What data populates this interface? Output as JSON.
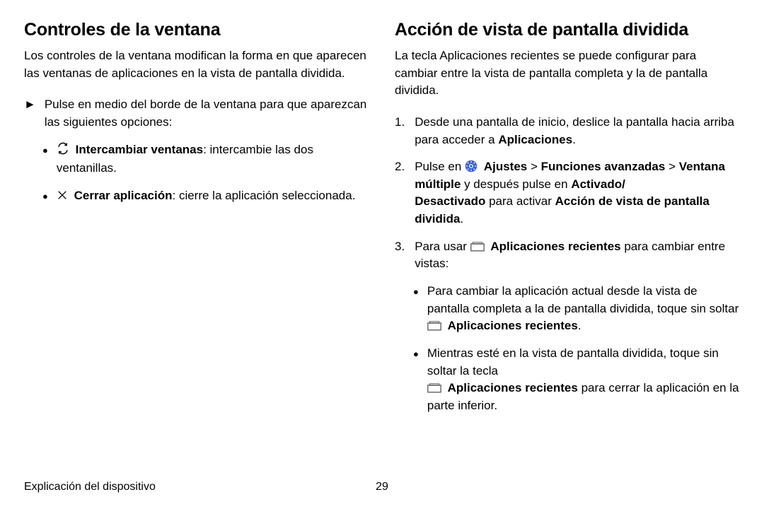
{
  "left": {
    "heading": "Controles de la ventana",
    "lead": "Los controles de la ventana modifican la forma en que aparecen las ventanas de aplicaciones en la vista de pantalla dividida.",
    "arrow_text": "Pulse en medio del borde de la ventana para que aparezcan las siguientes opciones:",
    "sub1_bold": "Intercambiar ventanas",
    "sub1_rest": ": intercambie las dos ventanillas.",
    "sub2_bold": "Cerrar aplicación",
    "sub2_rest": ": cierre la aplicación seleccionada."
  },
  "right": {
    "heading": "Acción de vista de pantalla dividida",
    "lead": "La tecla Aplicaciones recientes se puede configurar para cambiar entre la vista de pantalla completa y la de pantalla dividida.",
    "s1a": "Desde una pantalla de inicio, deslice la pantalla hacia arriba para acceder a ",
    "s1b": "Aplicaciones",
    "s1c": ".",
    "s2a": "Pulse en ",
    "s2b": "Ajustes",
    "s2c": " > ",
    "s2d": "Funciones avanzadas",
    "s2e": " > ",
    "s2f": "Ventana múltiple",
    "s2g": " y después pulse en ",
    "s2h": "Activado/",
    "s2h2": "Desactivado",
    "s2i": " para activar ",
    "s2j": "Acción de vista de pantalla dividida",
    "s2k": ".",
    "s3a": "Para usar ",
    "s3b": "Aplicaciones recientes",
    "s3c": " para cambiar entre vistas:",
    "b1a": "Para cambiar la aplicación actual desde la vista de pantalla completa a la de pantalla dividida, toque sin soltar ",
    "b1b": "Aplicaciones recientes",
    "b1c": ".",
    "b2a": "Mientras esté en la vista de pantalla dividida, toque sin soltar la tecla ",
    "b2b": "Aplicaciones recientes",
    "b2c": " para cerrar la aplicación en la parte inferior."
  },
  "footer": {
    "title": "Explicación del dispositivo",
    "page": "29"
  },
  "markers": {
    "arrow": "►",
    "bullet": "●",
    "n1": "1.",
    "n2": "2.",
    "n3": "3."
  }
}
